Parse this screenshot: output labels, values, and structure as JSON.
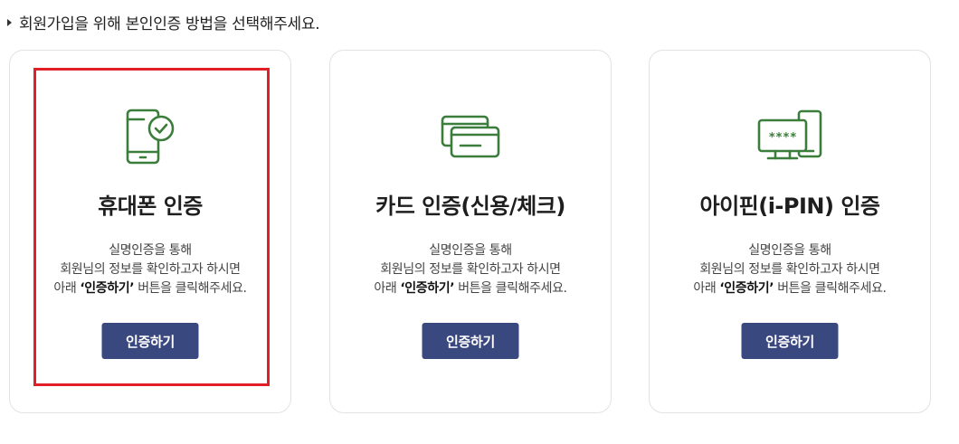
{
  "intro": {
    "text": "회원가입을 위해 본인인증 방법을 선택해주세요."
  },
  "colors": {
    "icon": "#3b7d3b",
    "button": "#3a4880",
    "selection": "#e02026"
  },
  "methods": [
    {
      "title": "휴대폰 인증",
      "icon": "phone-check-icon",
      "desc_line1": "실명인증을 통해",
      "desc_line2": "회원님의 정보를 확인하고자 하시면",
      "desc_prefix": "아래 ",
      "desc_bold": "‘인증하기’",
      "desc_suffix": " 버튼을 클릭해주세요.",
      "button_label": "인증하기",
      "selected": true
    },
    {
      "title": "카드 인증(신용/체크)",
      "icon": "credit-card-icon",
      "desc_line1": "실명인증을 통해",
      "desc_line2": "회원님의 정보를 확인하고자 하시면",
      "desc_prefix": "아래 ",
      "desc_bold": "‘인증하기’",
      "desc_suffix": " 버튼을 클릭해주세요.",
      "button_label": "인증하기",
      "selected": false
    },
    {
      "title": "아이핀(i-PIN) 인증",
      "icon": "ipin-monitor-icon",
      "pin_mask": "****",
      "desc_line1": "실명인증을 통해",
      "desc_line2": "회원님의 정보를 확인하고자 하시면",
      "desc_prefix": "아래 ",
      "desc_bold": "‘인증하기’",
      "desc_suffix": " 버튼을 클릭해주세요.",
      "button_label": "인증하기",
      "selected": false
    }
  ]
}
